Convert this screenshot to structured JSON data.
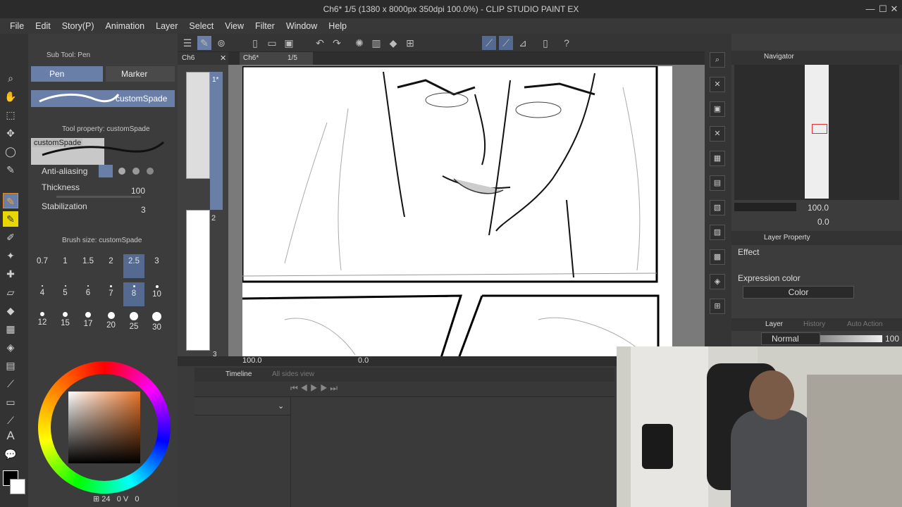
{
  "window": {
    "title": "Ch6* 1/5 (1380 x 8000px 350dpi 100.0%) - CLIP STUDIO PAINT EX"
  },
  "menu": [
    "File",
    "Edit",
    "Story(P)",
    "Animation",
    "Layer",
    "Select",
    "View",
    "Filter",
    "Window",
    "Help"
  ],
  "subtool": {
    "header": "Sub Tool: Pen",
    "tab_pen": "Pen",
    "tab_marker": "Marker",
    "brush_name": "customSpade"
  },
  "tool_property": {
    "header": "Tool property: customSpade",
    "preview_label": "customSpade",
    "anti_aliasing": "Anti-aliasing",
    "thickness_label": "Thickness",
    "thickness_value": "100",
    "stabilization_label": "Stabilization",
    "stabilization_value": "3"
  },
  "brush_size": {
    "header": "Brush size: customSpade",
    "sizes": [
      "0.7",
      "1",
      "1.5",
      "2",
      "2.5",
      "3",
      "4",
      "5",
      "6",
      "7",
      "8",
      "10",
      "12",
      "15",
      "17",
      "20",
      "25",
      "30"
    ]
  },
  "color_footer": {
    "a": "24",
    "b": "0",
    "c": "0"
  },
  "document_tabs": {
    "pages_tab": "Ch6",
    "canvas_tab": "Ch6*",
    "canvas_page": "1/5"
  },
  "page_numbers": [
    "1*",
    "2",
    "3"
  ],
  "canvas_status": {
    "zoom": "100.0",
    "rotation": "0.0"
  },
  "timeline": {
    "tab": "Timeline",
    "tab2": "All sides view"
  },
  "navigator": {
    "header": "Navigator",
    "zoom": "100.0",
    "angle": "0.0"
  },
  "layer_property": {
    "header": "Layer Property",
    "effect": "Effect",
    "expression_color_label": "Expression color",
    "expression_color_value": "Color"
  },
  "layer_panel": {
    "tab_layer": "Layer",
    "tab_history": "History",
    "tab_auto": "Auto Action",
    "blend_mode": "Normal",
    "opacity": "100"
  },
  "colors": {
    "accent": "#6a7fa8",
    "canvas_bg": "#7a7a7a",
    "panel": "#3c3c3c"
  }
}
